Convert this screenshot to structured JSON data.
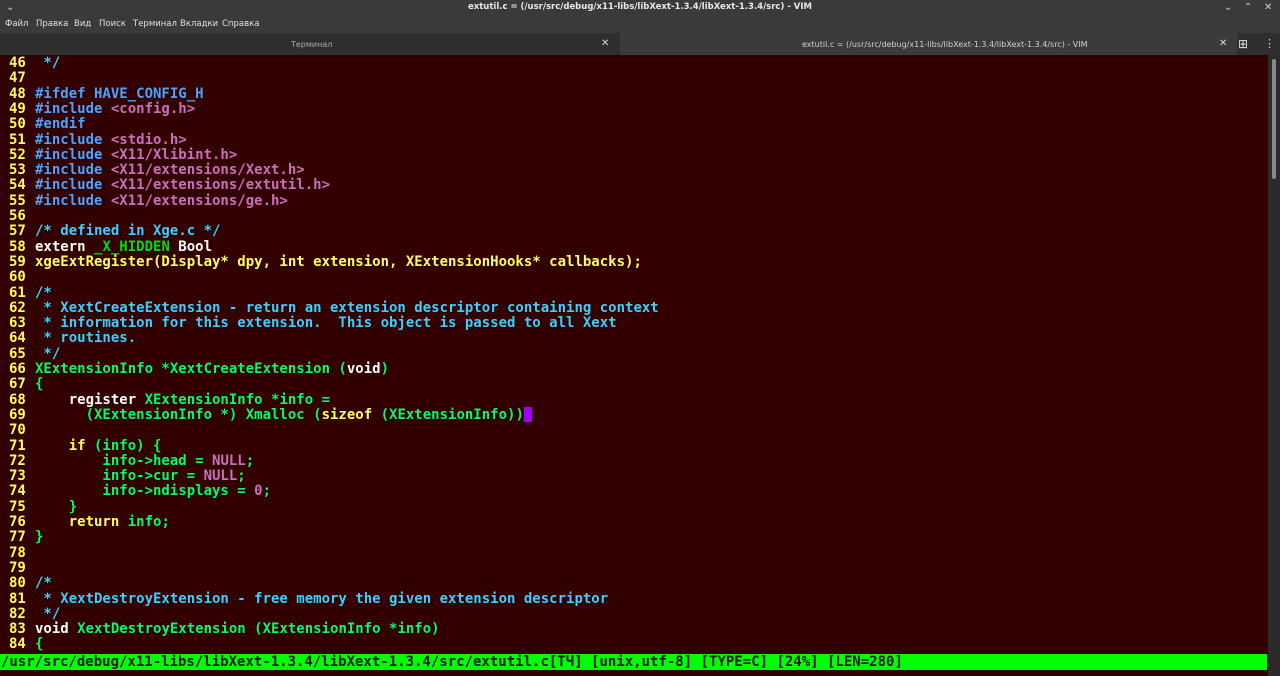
{
  "window": {
    "title": "extutil.c = (/usr/src/debug/x11-libs/libXext-1.3.4/libXext-1.3.4/src) - VIM",
    "app_menu_icon": "chevron-down-icon",
    "controls": [
      "minimize-icon",
      "maximize-icon",
      "close-icon"
    ]
  },
  "menu": [
    "Файл",
    "Правка",
    "Вид",
    "Поиск",
    "Терминал",
    "Вкладки",
    "Справка"
  ],
  "tabs": [
    {
      "label": "Терминал",
      "active": false
    },
    {
      "label": "extutil.c = (/usr/src/debug/x11-libs/libXext-1.3.4/libXext-1.3.4/src) - VIM",
      "active": true
    }
  ],
  "colors": {
    "editor_bg": "#330000",
    "line_number": "#ffff60",
    "preprocessor": "#4aa3ff",
    "string": "#c96fc0",
    "comment": "#3ad0ff",
    "type": "#00e000",
    "identifier": "#00ff60",
    "statement": "#ffff60",
    "plain": "#ffffff",
    "cursor": "#9b00ff",
    "statusbar_bg": "#00ff00"
  },
  "lines": [
    {
      "n": "46",
      "segs": [
        [
          " */",
          "#3ad0ff"
        ]
      ]
    },
    {
      "n": "47",
      "segs": []
    },
    {
      "n": "48",
      "segs": [
        [
          "#ifdef HAVE_CONFIG_H",
          "#4aa3ff"
        ]
      ]
    },
    {
      "n": "49",
      "segs": [
        [
          "#include ",
          "#4aa3ff"
        ],
        [
          "<config.h>",
          "#c96fc0"
        ]
      ]
    },
    {
      "n": "50",
      "segs": [
        [
          "#endif",
          "#4aa3ff"
        ]
      ]
    },
    {
      "n": "51",
      "segs": [
        [
          "#include ",
          "#4aa3ff"
        ],
        [
          "<stdio.h>",
          "#c96fc0"
        ]
      ]
    },
    {
      "n": "52",
      "segs": [
        [
          "#include ",
          "#4aa3ff"
        ],
        [
          "<X11/Xlibint.h>",
          "#c96fc0"
        ]
      ]
    },
    {
      "n": "53",
      "segs": [
        [
          "#include ",
          "#4aa3ff"
        ],
        [
          "<X11/extensions/Xext.h>",
          "#c96fc0"
        ]
      ]
    },
    {
      "n": "54",
      "segs": [
        [
          "#include ",
          "#4aa3ff"
        ],
        [
          "<X11/extensions/extutil.h>",
          "#c96fc0"
        ]
      ]
    },
    {
      "n": "55",
      "segs": [
        [
          "#include ",
          "#4aa3ff"
        ],
        [
          "<X11/extensions/ge.h>",
          "#c96fc0"
        ]
      ]
    },
    {
      "n": "56",
      "segs": []
    },
    {
      "n": "57",
      "segs": [
        [
          "/* defined in Xge.c */",
          "#3ad0ff"
        ]
      ]
    },
    {
      "n": "58",
      "segs": [
        [
          "extern ",
          "#ffffff"
        ],
        [
          "_X_HIDDEN",
          "#00e000"
        ],
        [
          " Bool",
          "#ffffff"
        ]
      ]
    },
    {
      "n": "59",
      "segs": [
        [
          "xgeExtRegister(Display* dpy, int extension, XExtensionHooks* callbacks);",
          "#ffff60"
        ]
      ]
    },
    {
      "n": "60",
      "segs": []
    },
    {
      "n": "61",
      "segs": [
        [
          "/*",
          "#3ad0ff"
        ]
      ]
    },
    {
      "n": "62",
      "segs": [
        [
          " * XextCreateExtension - return an extension descriptor containing context",
          "#3ad0ff"
        ]
      ]
    },
    {
      "n": "63",
      "segs": [
        [
          " * information for this extension.  This object is passed to all Xext",
          "#3ad0ff"
        ]
      ]
    },
    {
      "n": "64",
      "segs": [
        [
          " * routines.",
          "#3ad0ff"
        ]
      ]
    },
    {
      "n": "65",
      "segs": [
        [
          " */",
          "#3ad0ff"
        ]
      ]
    },
    {
      "n": "66",
      "segs": [
        [
          "XExtensionInfo *XextCreateExtension (",
          "#00ff60"
        ],
        [
          "void",
          "#ffffff"
        ],
        [
          ")",
          "#00ff60"
        ]
      ]
    },
    {
      "n": "67",
      "segs": [
        [
          "{",
          "#00ff60"
        ]
      ]
    },
    {
      "n": "68",
      "segs": [
        [
          "    register ",
          "#ffffff"
        ],
        [
          "XExtensionInfo *info =",
          "#00ff60"
        ]
      ]
    },
    {
      "n": "69",
      "segs": [
        [
          "      (XExtensionInfo *) Xmalloc (",
          "#00ff60"
        ],
        [
          "sizeof",
          "#ffff60"
        ],
        [
          " (XExtensionInfo))",
          "#00ff60"
        ]
      ],
      "cursor": true
    },
    {
      "n": "70",
      "segs": []
    },
    {
      "n": "71",
      "segs": [
        [
          "    if",
          "#ffff60"
        ],
        [
          " (info) {",
          "#00ff60"
        ]
      ]
    },
    {
      "n": "72",
      "segs": [
        [
          "        info->head = ",
          "#00ff60"
        ],
        [
          "NULL",
          "#c96fc0"
        ],
        [
          ";",
          "#00ff60"
        ]
      ]
    },
    {
      "n": "73",
      "segs": [
        [
          "        info->cur = ",
          "#00ff60"
        ],
        [
          "NULL",
          "#c96fc0"
        ],
        [
          ";",
          "#00ff60"
        ]
      ]
    },
    {
      "n": "74",
      "segs": [
        [
          "        info->ndisplays = ",
          "#00ff60"
        ],
        [
          "0",
          "#c96fc0"
        ],
        [
          ";",
          "#00ff60"
        ]
      ]
    },
    {
      "n": "75",
      "segs": [
        [
          "    }",
          "#00ff60"
        ]
      ]
    },
    {
      "n": "76",
      "segs": [
        [
          "    return",
          "#ffff60"
        ],
        [
          " info;",
          "#00ff60"
        ]
      ]
    },
    {
      "n": "77",
      "segs": [
        [
          "}",
          "#00ff60"
        ]
      ]
    },
    {
      "n": "78",
      "segs": []
    },
    {
      "n": "79",
      "segs": []
    },
    {
      "n": "80",
      "segs": [
        [
          "/*",
          "#3ad0ff"
        ]
      ]
    },
    {
      "n": "81",
      "segs": [
        [
          " * XextDestroyExtension - free memory the given extension descriptor",
          "#3ad0ff"
        ]
      ]
    },
    {
      "n": "82",
      "segs": [
        [
          " */",
          "#3ad0ff"
        ]
      ]
    },
    {
      "n": "83",
      "segs": [
        [
          "void ",
          "#ffffff"
        ],
        [
          "XextDestroyExtension (XExtensionInfo *info)",
          "#00ff60"
        ]
      ]
    },
    {
      "n": "84",
      "segs": [
        [
          "{",
          "#00ff60"
        ]
      ]
    }
  ],
  "status": "/usr/src/debug/x11-libs/libXext-1.3.4/libXext-1.3.4/src/extutil.c[ТЧ] [unix,utf-8] [TYPE=C] [24%] [LEN=280]"
}
